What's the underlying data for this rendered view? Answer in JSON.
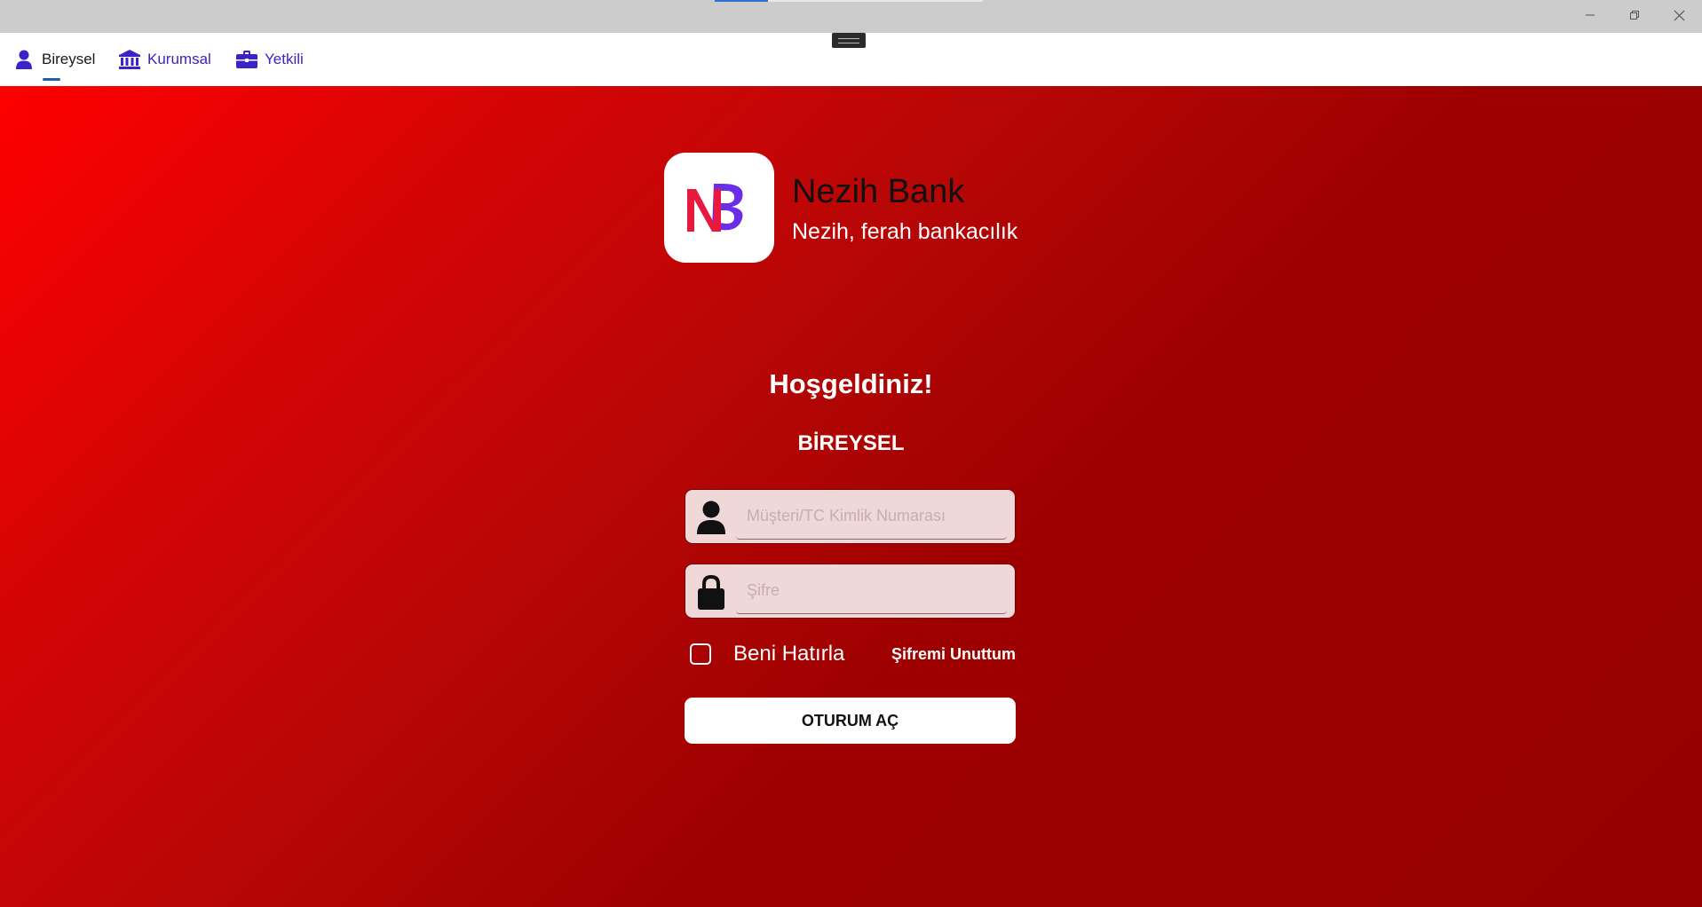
{
  "window": {
    "progress": 0.2,
    "controls": {
      "minimize": "minimize-icon",
      "restore": "restore-icon",
      "close": "close-icon"
    }
  },
  "tabs": [
    {
      "label": "Bireysel",
      "icon": "person-icon",
      "active": true
    },
    {
      "label": "Kurumsal",
      "icon": "bank-building-icon",
      "active": false
    },
    {
      "label": "Yetkili",
      "icon": "briefcase-icon",
      "active": false
    }
  ],
  "brand": {
    "name": "Nezih Bank",
    "slogan": "Nezih, ferah bankacılık",
    "logo_letters": "NB",
    "colors": {
      "n": "#e8193f",
      "b": "#6a2ee8"
    }
  },
  "login": {
    "welcome": "Hoşgeldiniz!",
    "segment": "BİREYSEL",
    "customer_id": {
      "value": "",
      "placeholder": "Müşteri/TC Kimlik Numarası",
      "icon": "user-icon"
    },
    "password": {
      "value": "",
      "placeholder": "Şifre",
      "icon": "lock-icon"
    },
    "remember_me": {
      "label": "Beni Hatırla",
      "checked": false
    },
    "forgot_password": "Şifremi Unuttum",
    "submit": "OTURUM AÇ"
  },
  "colors": {
    "accent": "#3a23c7",
    "background_top": "#ff0000",
    "background_bottom": "#980000"
  }
}
